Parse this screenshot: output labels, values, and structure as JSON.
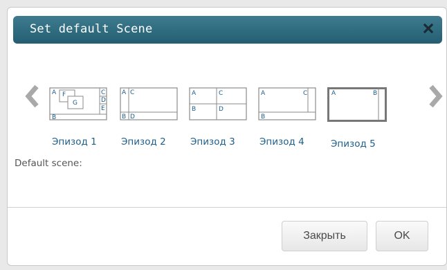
{
  "dialog": {
    "title": "Set default Scene",
    "close_icon": "close-icon"
  },
  "carousel": {
    "prev_icon": "chevron-left-icon",
    "next_icon": "chevron-right-icon",
    "episodes": [
      {
        "label": "Эпизод 1",
        "regions": [
          "A",
          "F",
          "G",
          "C",
          "D",
          "E",
          "B"
        ]
      },
      {
        "label": "Эпизод 2",
        "regions": [
          "A",
          "C",
          "B",
          "D"
        ]
      },
      {
        "label": "Эпизод 3",
        "regions": [
          "A",
          "C",
          "B",
          "D"
        ]
      },
      {
        "label": "Эпизод 4",
        "regions": [
          "A",
          "C",
          "B"
        ]
      },
      {
        "label": "Эпизод 5",
        "regions": [
          "A",
          "B"
        ]
      }
    ]
  },
  "default_scene": {
    "label": "Default scene:"
  },
  "footer": {
    "close_label": "Закрыть",
    "ok_label": "OK"
  },
  "colors": {
    "titlebar": "#2c6a7e",
    "link": "#1c5d8a",
    "border": "#9a9a9a"
  }
}
